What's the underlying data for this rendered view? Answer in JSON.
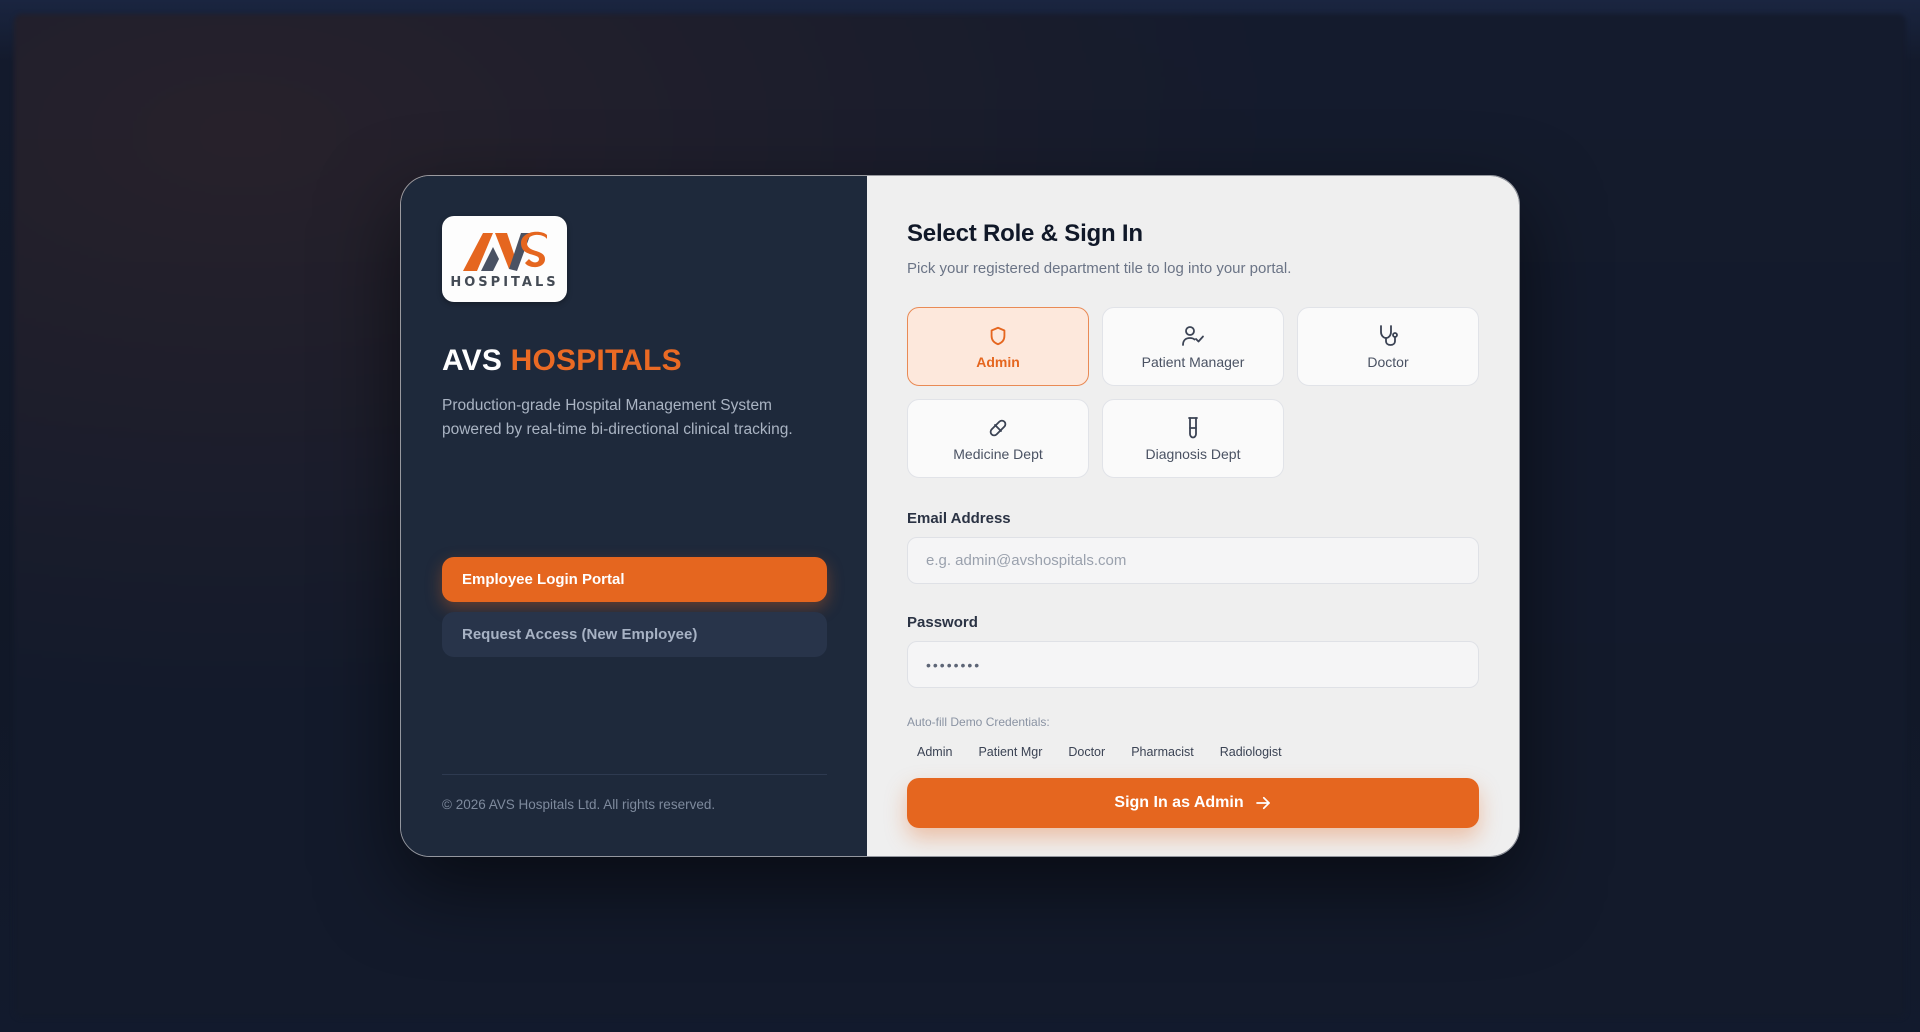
{
  "brand": {
    "logo_text": "HOSPITALS",
    "name_primary": "AVS",
    "name_accent": "HOSPITALS",
    "tagline": "Production-grade Hospital Management System powered by real-time bi-directional clinical tracking."
  },
  "nav": {
    "employee_login": "Employee Login Portal",
    "request_access": "Request Access (New Employee)"
  },
  "footer": {
    "copyright": "© 2026 AVS Hospitals Ltd. All rights reserved."
  },
  "signin": {
    "title": "Select Role & Sign In",
    "subtitle": "Pick your registered department tile to log into your portal.",
    "roles": [
      {
        "label": "Admin",
        "icon": "shield-icon",
        "active": true
      },
      {
        "label": "Patient Manager",
        "icon": "user-check-icon",
        "active": false
      },
      {
        "label": "Doctor",
        "icon": "stethoscope-icon",
        "active": false
      },
      {
        "label": "Medicine Dept",
        "icon": "pill-icon",
        "active": false
      },
      {
        "label": "Diagnosis Dept",
        "icon": "test-tube-icon",
        "active": false
      }
    ],
    "email_label": "Email Address",
    "email_placeholder": "e.g. admin@avshospitals.com",
    "password_label": "Password",
    "password_value": "••••••••",
    "demo_label": "Auto-fill Demo Credentials:",
    "demo_chips": [
      "Admin",
      "Patient Mgr",
      "Doctor",
      "Pharmacist",
      "Radiologist"
    ],
    "submit_label": "Sign In as Admin"
  },
  "colors": {
    "accent": "#e5661f",
    "panel_dark": "#1e293b",
    "panel_light": "#efefef"
  }
}
